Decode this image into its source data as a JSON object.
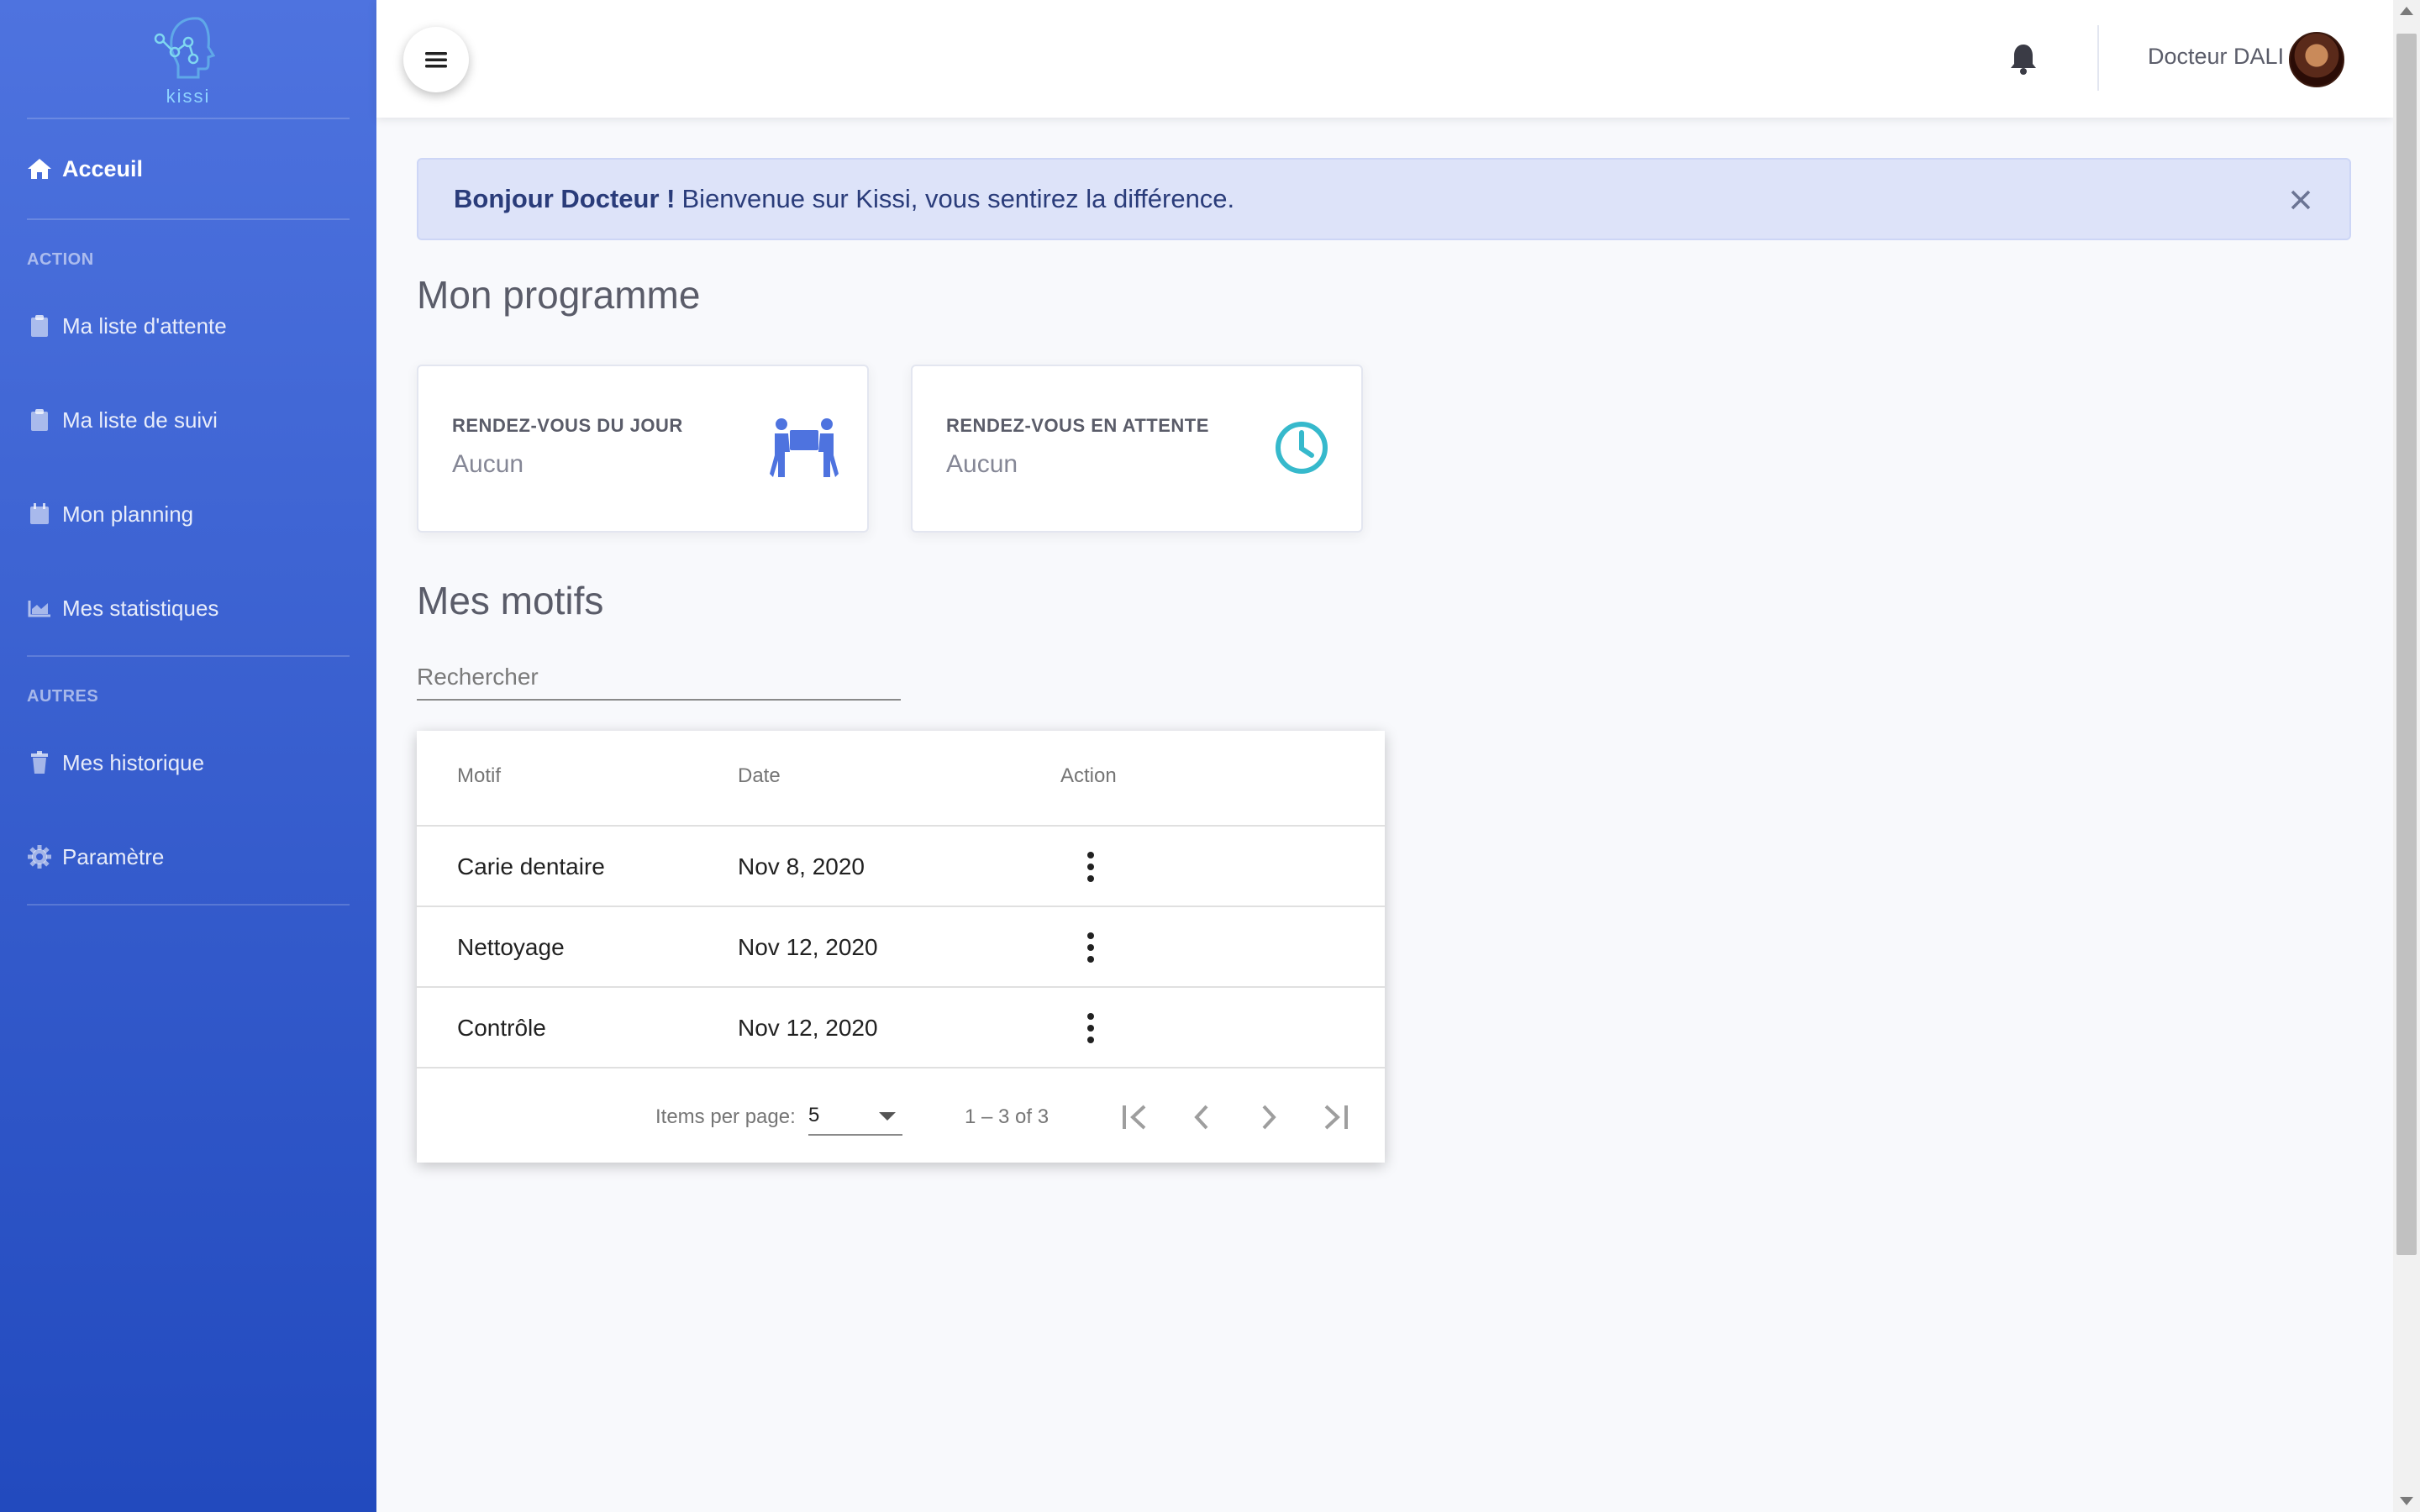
{
  "brand": {
    "name": "kissi"
  },
  "sidebar": {
    "home": "Acceuil",
    "section_action": "ACTION",
    "action_items": [
      {
        "label": "Ma liste d'attente",
        "icon": "clipboard-icon"
      },
      {
        "label": "Ma liste de suivi",
        "icon": "clipboard-icon"
      },
      {
        "label": "Mon planning",
        "icon": "calendar-icon"
      },
      {
        "label": "Mes statistiques",
        "icon": "area-chart-icon"
      }
    ],
    "section_autres": "AUTRES",
    "other_items": [
      {
        "label": "Mes historique",
        "icon": "trash-icon"
      },
      {
        "label": "Paramètre",
        "icon": "gear-icon"
      }
    ]
  },
  "topbar": {
    "user_name": "Docteur DALI"
  },
  "alert": {
    "strong": "Bonjour Docteur !",
    "message": "Bienvenue sur Kissi, vous sentirez la différence."
  },
  "program": {
    "title": "Mon programme",
    "cards": [
      {
        "caption": "RENDEZ-VOUS DU JOUR",
        "value": "Aucun",
        "icon": "people-carry-icon",
        "color": "#4e73df"
      },
      {
        "caption": "RENDEZ-VOUS EN ATTENTE",
        "value": "Aucun",
        "icon": "clock-icon",
        "color": "#36b9cc"
      }
    ]
  },
  "motifs": {
    "title": "Mes motifs",
    "search_placeholder": "Rechercher",
    "columns": [
      "Motif",
      "Date",
      "Action"
    ],
    "rows": [
      {
        "motif": "Carie dentaire",
        "date": "Nov 8, 2020"
      },
      {
        "motif": "Nettoyage",
        "date": "Nov 12, 2020"
      },
      {
        "motif": "Contrôle",
        "date": "Nov 12, 2020"
      }
    ],
    "paginator": {
      "items_per_page_label": "Items per page:",
      "page_size": "5",
      "range": "1 – 3 of 3"
    }
  }
}
